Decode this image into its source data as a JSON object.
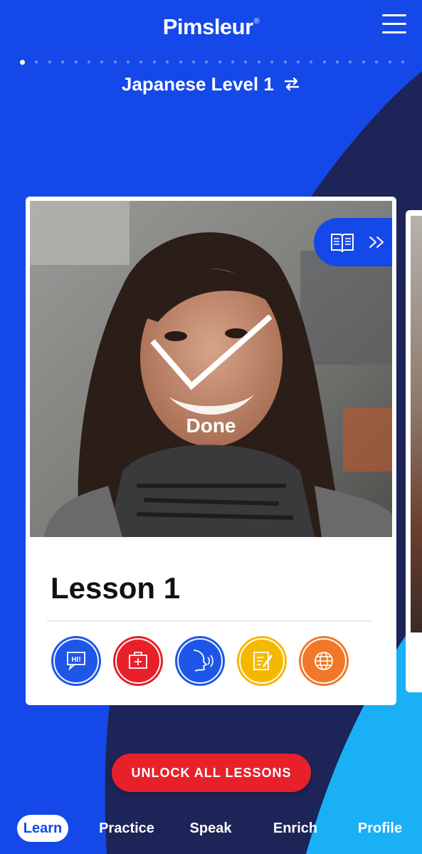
{
  "app": {
    "brand": "Pimsleur",
    "trademark": "®"
  },
  "header": {
    "menu_icon": "hamburger-menu-icon"
  },
  "carousel": {
    "total_dots": 30,
    "active_index": 0
  },
  "course": {
    "title": "Japanese Level 1",
    "switch_icon": "swap-arrows-icon"
  },
  "lesson_card": {
    "title": "Lesson 1",
    "status": "Done",
    "book_icon": "reading-book-icon",
    "forward_icon": "double-chevron-right-icon",
    "activities": [
      {
        "name": "flash-cards-icon",
        "color": "#1e56e8"
      },
      {
        "name": "quick-match-icon",
        "color": "#e8202a"
      },
      {
        "name": "speak-easy-icon",
        "color": "#1e56e8"
      },
      {
        "name": "reading-icon",
        "color": "#f5b800"
      },
      {
        "name": "culture-icon",
        "color": "#f07828"
      }
    ]
  },
  "cta": {
    "unlock_label": "UNLOCK ALL LESSONS"
  },
  "tabs": [
    {
      "label": "Learn",
      "active": true
    },
    {
      "label": "Practice",
      "active": false
    },
    {
      "label": "Speak",
      "active": false
    },
    {
      "label": "Enrich",
      "active": false
    },
    {
      "label": "Profile",
      "active": false
    }
  ],
  "colors": {
    "primary_blue": "#1548e8",
    "navy": "#1d2458",
    "light_blue": "#1ab0f6",
    "red": "#e8202a"
  }
}
